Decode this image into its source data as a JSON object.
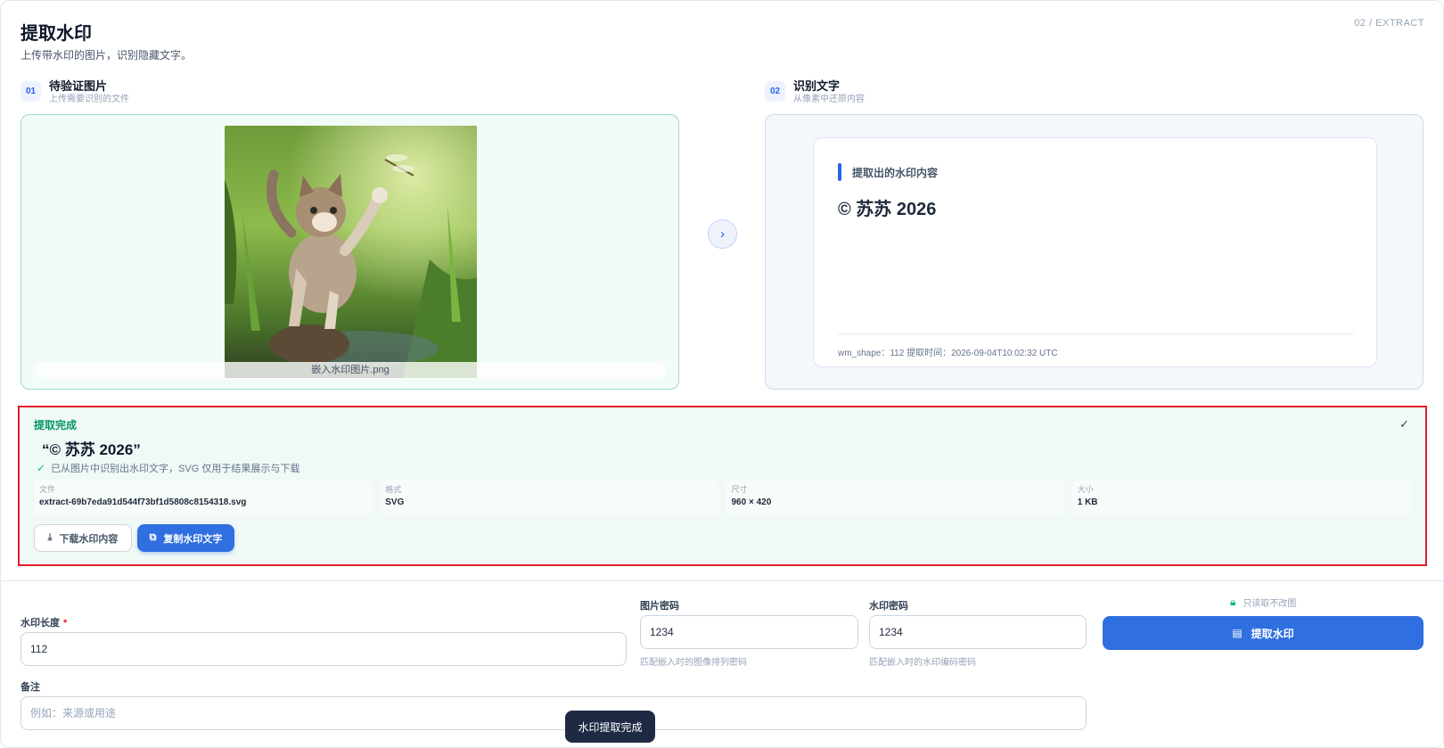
{
  "header": {
    "title": "提取水印",
    "subtitle": "上传带水印的图片，识别隐藏文字。",
    "step": "02 / EXTRACT"
  },
  "source": {
    "num": "01",
    "title": "待验证图片",
    "desc": "上传需要识别的文件",
    "file_name": "嵌入水印图片.png"
  },
  "result": {
    "num": "02",
    "title": "识别文字",
    "desc": "从像素中还原内容",
    "label": "提取出的水印内容",
    "text": "© 苏苏 2026",
    "meta": "wm_shape：112 提取时间：2026-09-04T10:02:32 UTC"
  },
  "done": {
    "title": "提取完成",
    "quote": "“© 苏苏 2026”",
    "note": "已从图片中识别出水印文字，SVG 仅用于结果展示与下载",
    "meta": [
      {
        "key": "文件",
        "value": "extract-69b7eda91d544f73bf1d5808c8154318.svg"
      },
      {
        "key": "格式",
        "value": "SVG"
      },
      {
        "key": "尺寸",
        "value": "960 × 420"
      },
      {
        "key": "大小",
        "value": "1 KB"
      }
    ],
    "download_label": "下载水印内容",
    "copy_label": "复制水印文字"
  },
  "form": {
    "length_label": "水印长度",
    "length_required": "*",
    "length_value": "112",
    "image_pwd_label": "图片密码",
    "image_pwd_value": "1234",
    "image_pwd_hint": "匹配嵌入时的图像排列密码",
    "wm_pwd_label": "水印密码",
    "wm_pwd_value": "1234",
    "wm_pwd_hint": "匹配嵌入时的水印编码密码",
    "readonly_note": "只读取不改图",
    "extract_label": "提取水印",
    "remark_label": "备注",
    "remark_placeholder": "例如：来源或用途"
  },
  "toast": "水印提取完成",
  "colors": {
    "accent": "#2f6fe0",
    "success": "#059669",
    "highlight_border": "#e11d2a"
  }
}
